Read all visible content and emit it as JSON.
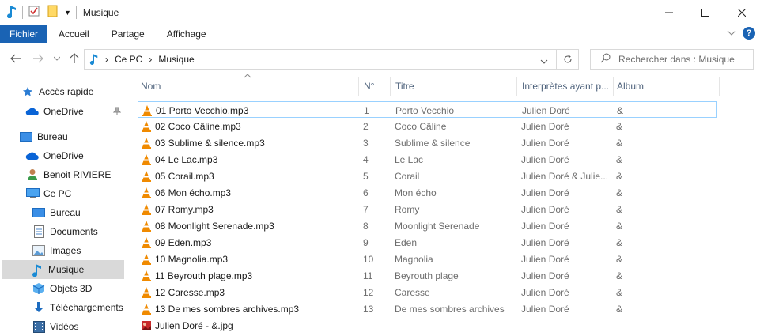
{
  "window": {
    "title": "Musique"
  },
  "ribbon": {
    "tabs": [
      "Fichier",
      "Accueil",
      "Partage",
      "Affichage"
    ],
    "help_label": "?"
  },
  "address": {
    "path": [
      "Ce PC",
      "Musique"
    ],
    "search_placeholder": "Rechercher dans : Musique"
  },
  "sidebar": {
    "items": [
      {
        "label": "Accès rapide",
        "icon": "star-icon"
      },
      {
        "label": "OneDrive",
        "icon": "cloud-icon"
      },
      {
        "label": "Bureau",
        "icon": "desktop-icon"
      },
      {
        "label": "OneDrive",
        "icon": "cloud-icon"
      },
      {
        "label": "Benoit RIVIERE",
        "icon": "user-icon"
      },
      {
        "label": "Ce PC",
        "icon": "computer-icon"
      },
      {
        "label": "Bureau",
        "icon": "desktop-icon"
      },
      {
        "label": "Documents",
        "icon": "document-icon"
      },
      {
        "label": "Images",
        "icon": "image-icon"
      },
      {
        "label": "Musique",
        "icon": "music-icon",
        "selected": true
      },
      {
        "label": "Objets 3D",
        "icon": "cube-icon"
      },
      {
        "label": "Téléchargements",
        "icon": "download-icon"
      },
      {
        "label": "Vidéos",
        "icon": "video-icon"
      }
    ]
  },
  "columns": [
    "Nom",
    "N°",
    "Titre",
    "Interprètes ayant p...",
    "Album"
  ],
  "files": [
    {
      "name": "01 Porto Vecchio.mp3",
      "num": "1",
      "title": "Porto Vecchio",
      "artist": "Julien Doré",
      "album": "&"
    },
    {
      "name": "02 Coco Câline.mp3",
      "num": "2",
      "title": "Coco Câline",
      "artist": "Julien Doré",
      "album": "&"
    },
    {
      "name": "03 Sublime & silence.mp3",
      "num": "3",
      "title": "Sublime & silence",
      "artist": "Julien Doré",
      "album": "&"
    },
    {
      "name": "04 Le Lac.mp3",
      "num": "4",
      "title": "Le Lac",
      "artist": "Julien Doré",
      "album": "&"
    },
    {
      "name": "05 Corail.mp3",
      "num": "5",
      "title": "Corail",
      "artist": "Julien Doré & Julie...",
      "album": "&"
    },
    {
      "name": "06 Mon écho.mp3",
      "num": "6",
      "title": "Mon écho",
      "artist": "Julien Doré",
      "album": "&"
    },
    {
      "name": "07 Romy.mp3",
      "num": "7",
      "title": "Romy",
      "artist": "Julien Doré",
      "album": "&"
    },
    {
      "name": "08 Moonlight Serenade.mp3",
      "num": "8",
      "title": "Moonlight Serenade",
      "artist": "Julien Doré",
      "album": "&"
    },
    {
      "name": "09 Eden.mp3",
      "num": "9",
      "title": "Eden",
      "artist": "Julien Doré",
      "album": "&"
    },
    {
      "name": "10 Magnolia.mp3",
      "num": "10",
      "title": "Magnolia",
      "artist": "Julien Doré",
      "album": "&"
    },
    {
      "name": "11 Beyrouth plage.mp3",
      "num": "11",
      "title": "Beyrouth plage",
      "artist": "Julien Doré",
      "album": "&"
    },
    {
      "name": "12 Caresse.mp3",
      "num": "12",
      "title": "Caresse",
      "artist": "Julien Doré",
      "album": "&"
    },
    {
      "name": "13 De mes sombres archives.mp3",
      "num": "13",
      "title": "De mes sombres archives",
      "artist": "Julien Doré",
      "album": "&"
    },
    {
      "name": "Julien Doré - &.jpg",
      "num": "",
      "title": "",
      "artist": "",
      "album": "",
      "icon": "image-file-icon"
    }
  ],
  "colors": {
    "accent": "#1a63b4",
    "selection": "#d9d9d9",
    "focus_border": "#99d1ff",
    "vlc_orange": "#f08a00"
  }
}
